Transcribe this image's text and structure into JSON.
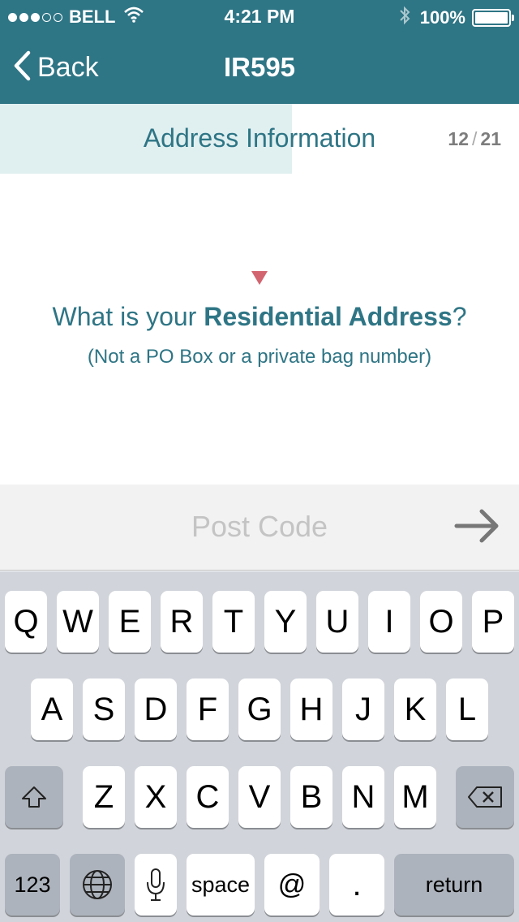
{
  "status_bar": {
    "carrier": "BELL",
    "time": "4:21 PM",
    "battery": "100%",
    "signal_bars_filled": 3,
    "signal_bars_total": 5
  },
  "nav": {
    "back_label": "Back",
    "title": "IR595"
  },
  "section": {
    "title": "Address Information",
    "step_current": "12",
    "step_separator": "/",
    "step_total": "21",
    "progress_fraction": 0.5625
  },
  "question": {
    "prefix": "What is your ",
    "emphasis": "Residential Address",
    "suffix": "?",
    "note": "(Not a PO Box or a private bag number)"
  },
  "input": {
    "placeholder": "Post Code",
    "value": ""
  },
  "keyboard": {
    "row1": [
      "Q",
      "W",
      "E",
      "R",
      "T",
      "Y",
      "U",
      "I",
      "O",
      "P"
    ],
    "row2": [
      "A",
      "S",
      "D",
      "F",
      "G",
      "H",
      "J",
      "K",
      "L"
    ],
    "row3": [
      "Z",
      "X",
      "C",
      "V",
      "B",
      "N",
      "M"
    ],
    "numbers_label": "123",
    "space_label": "space",
    "at_label": "@",
    "period_label": ".",
    "return_label": "return"
  },
  "colors": {
    "brand": "#2e7585",
    "progress": "#e0eff0",
    "marker": "#d26470"
  },
  "icons": {
    "back": "chevron-left-icon",
    "wifi": "wifi-icon",
    "bluetooth": "bluetooth-icon",
    "battery": "battery-icon",
    "next": "arrow-right-icon",
    "shift": "shift-icon",
    "delete": "backspace-icon",
    "globe": "globe-icon",
    "mic": "microphone-icon"
  }
}
